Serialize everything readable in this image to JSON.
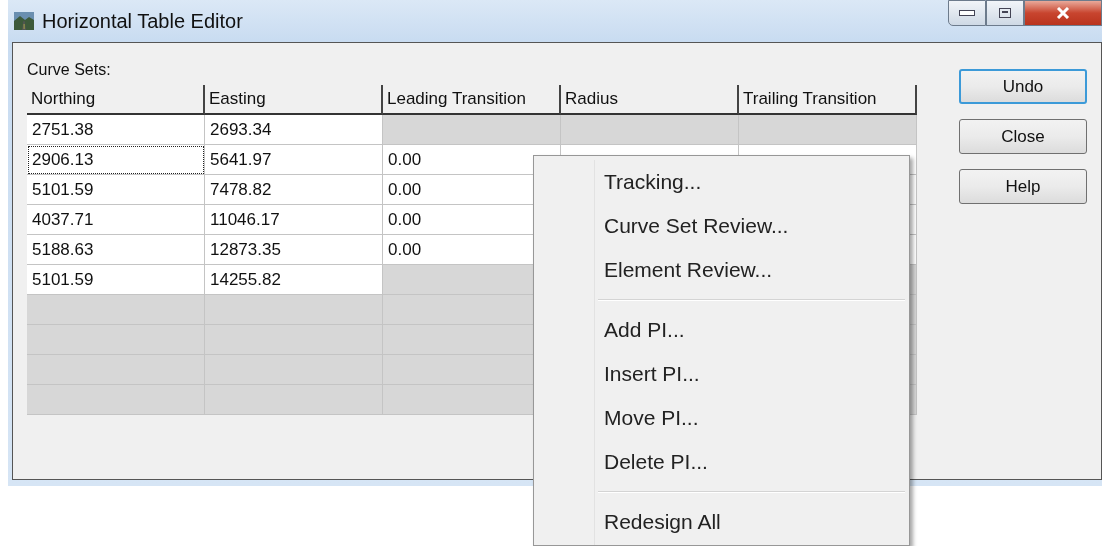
{
  "window": {
    "title": "Horizontal Table Editor"
  },
  "table": {
    "label": "Curve Sets:",
    "columns": [
      "Northing",
      "Easting",
      "Leading Transition",
      "Radius",
      "Trailing Transition"
    ],
    "rows": [
      {
        "cells": [
          {
            "text": "2751.38",
            "disabled": false,
            "focused": false
          },
          {
            "text": "2693.34",
            "disabled": false,
            "focused": false
          },
          {
            "disabled": true,
            "focused": false
          },
          {
            "disabled": true,
            "focused": false
          },
          {
            "disabled": true,
            "focused": false
          }
        ]
      },
      {
        "cells": [
          {
            "text": "2906.13",
            "disabled": false,
            "focused": true
          },
          {
            "text": "5641.97",
            "disabled": false,
            "focused": false
          },
          {
            "text": "0.00",
            "disabled": false,
            "focused": false
          },
          null,
          {
            "disabled": false,
            "focused": false
          }
        ]
      },
      {
        "cells": [
          {
            "text": "5101.59",
            "disabled": false,
            "focused": false
          },
          {
            "text": "7478.82",
            "disabled": false,
            "focused": false
          },
          {
            "text": "0.00",
            "disabled": false,
            "focused": false
          },
          null,
          {
            "disabled": false,
            "focused": false
          }
        ]
      },
      {
        "cells": [
          {
            "text": "4037.71",
            "disabled": false,
            "focused": false
          },
          {
            "text": "11046.17",
            "disabled": false,
            "focused": false
          },
          {
            "text": "0.00",
            "disabled": false,
            "focused": false
          },
          null,
          {
            "disabled": false,
            "focused": false
          }
        ]
      },
      {
        "cells": [
          {
            "text": "5188.63",
            "disabled": false,
            "focused": false
          },
          {
            "text": "12873.35",
            "disabled": false,
            "focused": false
          },
          {
            "text": "0.00",
            "disabled": false,
            "focused": false
          },
          null,
          {
            "disabled": false,
            "focused": false
          }
        ]
      },
      {
        "cells": [
          {
            "text": "5101.59",
            "disabled": false,
            "focused": false
          },
          {
            "text": "14255.82",
            "disabled": false,
            "focused": false
          },
          {
            "disabled": true,
            "focused": false
          },
          null,
          {
            "disabled": true,
            "focused": false
          }
        ]
      },
      {
        "cells": [
          {
            "disabled": true,
            "focused": false
          },
          {
            "disabled": true,
            "focused": false
          },
          {
            "disabled": true,
            "focused": false
          },
          null,
          {
            "disabled": true,
            "focused": false
          }
        ]
      },
      {
        "cells": [
          {
            "disabled": true,
            "focused": false
          },
          {
            "disabled": true,
            "focused": false
          },
          {
            "disabled": true,
            "focused": false
          },
          null,
          {
            "disabled": true,
            "focused": false
          }
        ]
      },
      {
        "cells": [
          {
            "disabled": true,
            "focused": false
          },
          {
            "disabled": true,
            "focused": false
          },
          {
            "disabled": true,
            "focused": false
          },
          null,
          {
            "disabled": true,
            "focused": false
          }
        ]
      },
      {
        "cells": [
          {
            "disabled": true,
            "focused": false
          },
          {
            "disabled": true,
            "focused": false
          },
          {
            "disabled": true,
            "focused": false
          },
          null,
          {
            "disabled": true,
            "focused": false
          }
        ]
      }
    ]
  },
  "buttons": [
    {
      "label": "Undo",
      "focused": true
    },
    {
      "label": "Close",
      "focused": false
    },
    {
      "label": "Help",
      "focused": false
    }
  ],
  "context_menu": {
    "items": [
      {
        "kind": "item",
        "label": "Tracking..."
      },
      {
        "kind": "item",
        "label": "Curve Set Review..."
      },
      {
        "kind": "item",
        "label": "Element Review..."
      },
      {
        "kind": "separator"
      },
      {
        "kind": "item",
        "label": "Add PI..."
      },
      {
        "kind": "item",
        "label": "Insert PI..."
      },
      {
        "kind": "item",
        "label": "Move PI..."
      },
      {
        "kind": "item",
        "label": "Delete PI..."
      },
      {
        "kind": "separator"
      },
      {
        "kind": "item",
        "label": "Redesign All"
      }
    ]
  }
}
